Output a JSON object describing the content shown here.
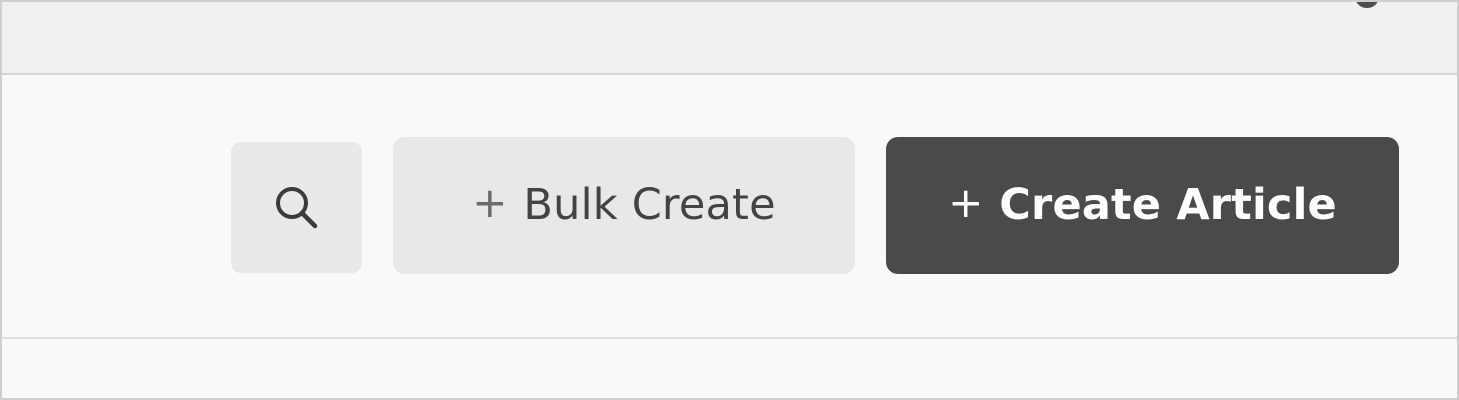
{
  "toolbar": {
    "search_icon": "search-icon",
    "bulk_create": {
      "icon": "+",
      "label": "Bulk Create"
    },
    "create_article": {
      "icon": "+",
      "label": "Create Article"
    }
  },
  "colors": {
    "primary_button": "#4a4a4a",
    "secondary_button": "#e8e8e8",
    "search_button": "#e9e9e9",
    "surface": "#f9f9f9",
    "top_bar": "#f1f1f1"
  }
}
